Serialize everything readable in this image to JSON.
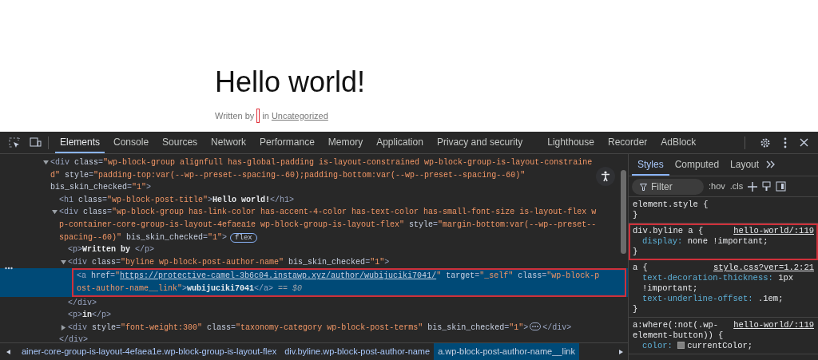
{
  "page": {
    "title": "Hello world!",
    "byline": {
      "prefix": "Written by",
      "marker_outlined": true,
      "middle": "in",
      "category": "Uncategorized"
    }
  },
  "devtools": {
    "tabs": [
      {
        "label": "Elements",
        "selected": true
      },
      {
        "label": "Console",
        "selected": false
      },
      {
        "label": "Sources",
        "selected": false
      },
      {
        "label": "Network",
        "selected": false
      },
      {
        "label": "Performance",
        "selected": false
      },
      {
        "label": "Memory",
        "selected": false
      },
      {
        "label": "Application",
        "selected": false
      },
      {
        "label": "Privacy and security",
        "selected": false
      },
      {
        "label": "Lighthouse",
        "selected": false
      },
      {
        "label": "Recorder",
        "selected": false
      },
      {
        "label": "AdBlock",
        "selected": false
      }
    ],
    "elements_tree": [
      {
        "expanded": true,
        "selected": false,
        "highlighted": false,
        "lines": [
          [
            {
              "kind": "tag",
              "text": "<div"
            },
            {
              "kind": "attr",
              "text": " class"
            },
            {
              "kind": "tag",
              "text": "="
            },
            {
              "kind": "value",
              "text": "\"wp-block-group alignfull has-global-padding is-layout-constrained wp-block-group-is-layout-constraine"
            }
          ],
          [
            {
              "kind": "value",
              "text": "d\""
            },
            {
              "kind": "attr",
              "text": " style"
            },
            {
              "kind": "tag",
              "text": "="
            },
            {
              "kind": "value",
              "text": "\"padding-top:var(--wp--preset--spacing--60);padding-bottom:var(--wp--preset--spacing--60)\""
            }
          ],
          [
            {
              "kind": "attr",
              "text": "bis_skin_checked"
            },
            {
              "kind": "tag",
              "text": "="
            },
            {
              "kind": "value",
              "text": "\"1\""
            },
            {
              "kind": "tag",
              "text": ">"
            }
          ]
        ],
        "children": [
          {
            "selected": false,
            "highlighted": false,
            "lines": [
              [
                {
                  "kind": "tag",
                  "text": "<h1"
                },
                {
                  "kind": "attr",
                  "text": " class"
                },
                {
                  "kind": "tag",
                  "text": "="
                },
                {
                  "kind": "value",
                  "text": "\"wp-block-post-title\""
                },
                {
                  "kind": "tag",
                  "text": ">"
                },
                {
                  "kind": "text",
                  "text": "Hello world!"
                },
                {
                  "kind": "tag",
                  "text": "</h1>"
                }
              ]
            ]
          },
          {
            "expanded": true,
            "selected": false,
            "highlighted": false,
            "badge": "flex",
            "lines": [
              [
                {
                  "kind": "tag",
                  "text": "<div"
                },
                {
                  "kind": "attr",
                  "text": " class"
                },
                {
                  "kind": "tag",
                  "text": "="
                },
                {
                  "kind": "value",
                  "text": "\"wp-block-group has-link-color has-accent-4-color has-text-color has-small-font-size is-layout-flex w"
                }
              ],
              [
                {
                  "kind": "value",
                  "text": "p-container-core-group-is-layout-4efaea1e wp-block-group-is-layout-flex\""
                },
                {
                  "kind": "attr",
                  "text": " style"
                },
                {
                  "kind": "tag",
                  "text": "="
                },
                {
                  "kind": "value",
                  "text": "\"margin-bottom:var(--wp--preset--"
                }
              ],
              [
                {
                  "kind": "value",
                  "text": "spacing--60)\""
                },
                {
                  "kind": "attr",
                  "text": " bis_skin_checked"
                },
                {
                  "kind": "tag",
                  "text": "="
                },
                {
                  "kind": "value",
                  "text": "\"1\""
                },
                {
                  "kind": "tag",
                  "text": ">"
                }
              ]
            ],
            "closing": [
              {
                "kind": "tag",
                "text": "</div>"
              }
            ],
            "children": [
              {
                "selected": false,
                "highlighted": false,
                "lines": [
                  [
                    {
                      "kind": "tag",
                      "text": "<p>"
                    },
                    {
                      "kind": "text",
                      "text": "Written by "
                    },
                    {
                      "kind": "tag",
                      "text": "</p>"
                    }
                  ]
                ]
              },
              {
                "expanded": true,
                "selected": false,
                "highlighted": false,
                "lines": [
                  [
                    {
                      "kind": "tag",
                      "text": "<div"
                    },
                    {
                      "kind": "attr",
                      "text": " class"
                    },
                    {
                      "kind": "tag",
                      "text": "="
                    },
                    {
                      "kind": "value",
                      "text": "\"byline wp-block-post-author-name\""
                    },
                    {
                      "kind": "attr",
                      "text": " bis_skin_checked"
                    },
                    {
                      "kind": "tag",
                      "text": "="
                    },
                    {
                      "kind": "value",
                      "text": "\"1\""
                    },
                    {
                      "kind": "tag",
                      "text": ">"
                    }
                  ]
                ],
                "closing": [
                  {
                    "kind": "tag",
                    "text": "</div>"
                  }
                ],
                "children": [
                  {
                    "selected": true,
                    "highlighted": true,
                    "lines": [
                      [
                        {
                          "kind": "tag",
                          "text": "<a"
                        },
                        {
                          "kind": "attr",
                          "text": " href"
                        },
                        {
                          "kind": "tag",
                          "text": "="
                        },
                        {
                          "kind": "value",
                          "text": "\""
                        },
                        {
                          "kind": "link",
                          "text": "https://protective-camel-3b6c04.instawp.xyz/author/wubijuciki7041/"
                        },
                        {
                          "kind": "value",
                          "text": "\""
                        },
                        {
                          "kind": "attr",
                          "text": " target"
                        },
                        {
                          "kind": "tag",
                          "text": "="
                        },
                        {
                          "kind": "value",
                          "text": "\"_self\""
                        },
                        {
                          "kind": "attr",
                          "text": " class"
                        },
                        {
                          "kind": "tag",
                          "text": "="
                        },
                        {
                          "kind": "value",
                          "text": "\"wp-block-p"
                        }
                      ],
                      [
                        {
                          "kind": "value",
                          "text": "ost-author-name__link\""
                        },
                        {
                          "kind": "tag",
                          "text": ">"
                        },
                        {
                          "kind": "text",
                          "text": "wubijuciki7041"
                        },
                        {
                          "kind": "tag",
                          "text": "</a>"
                        },
                        {
                          "kind": "ref",
                          "text": " == $0"
                        }
                      ]
                    ]
                  }
                ]
              },
              {
                "selected": false,
                "highlighted": false,
                "lines": [
                  [
                    {
                      "kind": "tag",
                      "text": "<p>"
                    },
                    {
                      "kind": "text",
                      "text": "in"
                    },
                    {
                      "kind": "tag",
                      "text": "</p>"
                    }
                  ]
                ]
              },
              {
                "expanded": false,
                "selected": false,
                "highlighted": false,
                "lines": [
                  [
                    {
                      "kind": "tag",
                      "text": "<div"
                    },
                    {
                      "kind": "attr",
                      "text": " style"
                    },
                    {
                      "kind": "tag",
                      "text": "="
                    },
                    {
                      "kind": "value",
                      "text": "\"font-weight:300\""
                    },
                    {
                      "kind": "attr",
                      "text": " class"
                    },
                    {
                      "kind": "tag",
                      "text": "="
                    },
                    {
                      "kind": "value",
                      "text": "\"taxonomy-category wp-block-post-terms\""
                    },
                    {
                      "kind": "attr",
                      "text": " bis_skin_checked"
                    },
                    {
                      "kind": "tag",
                      "text": "="
                    },
                    {
                      "kind": "value",
                      "text": "\"1\""
                    },
                    {
                      "kind": "tag",
                      "text": ">"
                    },
                    {
                      "kind": "ellipsis"
                    },
                    {
                      "kind": "tag",
                      "text": "</div>"
                    }
                  ]
                ]
              }
            ]
          }
        ]
      }
    ],
    "breadcrumbs": [
      {
        "label": "ainer-core-group-is-layout-4efaea1e.wp-block-group-is-layout-flex",
        "selected": false
      },
      {
        "label": "div.byline.wp-block-post-author-name",
        "selected": false
      },
      {
        "label": "a.wp-block-post-author-name__link",
        "selected": true
      }
    ],
    "sidebar_tabs": [
      {
        "label": "Styles",
        "selected": true
      },
      {
        "label": "Computed",
        "selected": false
      },
      {
        "label": "Layout",
        "selected": false
      }
    ],
    "filter": {
      "placeholder": "Filter"
    },
    "filter_toggles": [
      ":hov",
      ".cls"
    ],
    "rules": [
      {
        "selector": "element.style {",
        "highlighted": false,
        "close": "}"
      },
      {
        "selector": "div.byline a {",
        "source": "hello-world/:119",
        "highlighted": true,
        "declarations": [
          {
            "property": "display:",
            "value": "none !important;"
          }
        ],
        "close": "}"
      },
      {
        "selector": "a {",
        "source": "style.css?ver=1.2:21",
        "highlighted": false,
        "declarations": [
          {
            "property": "text-decoration-thickness:",
            "value": "1px !important;"
          },
          {
            "property": "text-underline-offset:",
            "value": ".1em;"
          }
        ],
        "close": "}"
      },
      {
        "selector": "a:where(:not(.wp-element-button)) {",
        "source": "hello-world/:119",
        "highlighted": false,
        "declarations": [
          {
            "property": "color:",
            "value": "currentColor;",
            "swatch": true
          }
        ]
      }
    ]
  }
}
